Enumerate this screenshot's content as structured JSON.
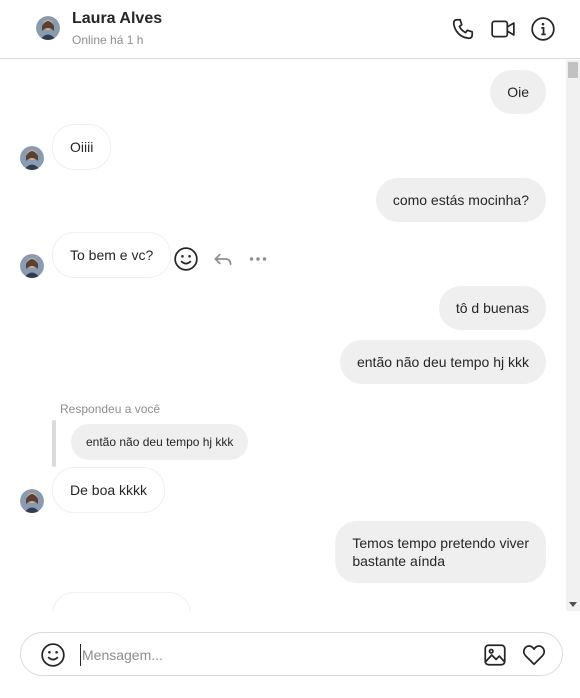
{
  "header": {
    "contact_name": "Laura Alves",
    "status": "Online há 1 h",
    "icons": [
      "phone-icon",
      "video-call-icon",
      "info-icon"
    ]
  },
  "messages": [
    {
      "direction": "outgoing",
      "text": "Oie"
    },
    {
      "direction": "incoming",
      "text": "Oiiii"
    },
    {
      "direction": "outgoing",
      "text": "como estás mocinha?"
    },
    {
      "direction": "incoming",
      "text": "To bem e vc?"
    },
    {
      "direction": "outgoing",
      "text": "tô d buenas"
    },
    {
      "direction": "outgoing",
      "text": "então não deu tempo hj kkk"
    },
    {
      "direction": "incoming",
      "text": "De boa kkkk"
    },
    {
      "direction": "outgoing",
      "text": "Temos tempo pretendo viver",
      "text_line2": "bastante aínda"
    },
    {
      "direction": "incoming",
      "text": ""
    }
  ],
  "reply": {
    "label": "Respondeu a você",
    "quoted_text": "então não deu tempo hj kkk"
  },
  "message_actions": [
    "react-emoji-icon",
    "reply-arrow-icon",
    "more-options-icon"
  ],
  "composer": {
    "placeholder": "Mensagem...",
    "value": "",
    "icons": [
      "emoji-icon",
      "image-icon",
      "heart-icon"
    ]
  },
  "colors": {
    "outgoing_bubble": "#efefef",
    "incoming_border": "#efefef",
    "divider": "#dbdbdb",
    "secondary_text": "#8e8e8e",
    "primary_text": "#262626"
  }
}
